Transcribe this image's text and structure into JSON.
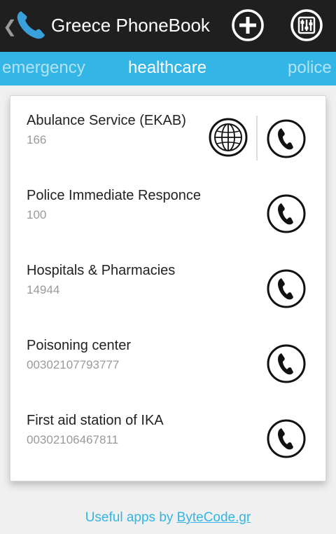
{
  "action_bar": {
    "title": "Greece PhoneBook",
    "icons": {
      "up": "chevron-left-icon",
      "app": "phone-icon",
      "add": "plus-circle-icon",
      "settings": "sliders-icon"
    }
  },
  "tabs": {
    "previous": "emergency",
    "current": "healthcare",
    "next": "police"
  },
  "contacts": [
    {
      "name": "Abulance Service (EKAB)",
      "number": "166",
      "has_website": true
    },
    {
      "name": "Police Immediate Responce",
      "number": "100",
      "has_website": false
    },
    {
      "name": "Hospitals & Pharmacies",
      "number": "14944",
      "has_website": false
    },
    {
      "name": "Poisoning center",
      "number": "00302107793777",
      "has_website": false
    },
    {
      "name": "First aid station of IKA",
      "number": "00302106467811",
      "has_website": false
    }
  ],
  "footer": {
    "prefix": "Useful apps by ",
    "link": "ByteCode.gr"
  },
  "colors": {
    "accent": "#33b5e5",
    "action_bar": "#1f1f1f",
    "background": "#f0f0f0",
    "app_icon": "#3aa0dc"
  }
}
